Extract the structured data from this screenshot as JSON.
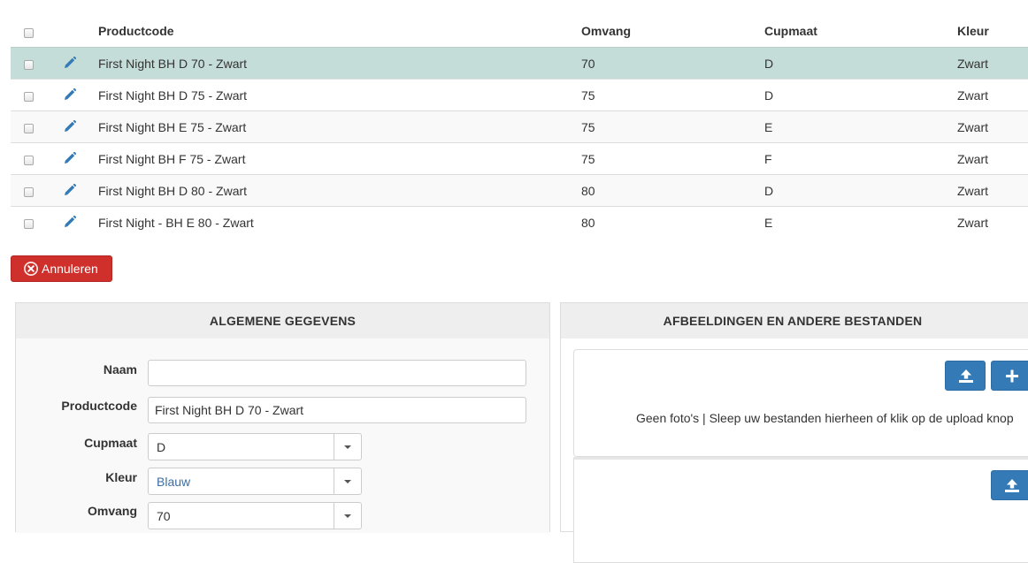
{
  "table": {
    "headers": {
      "productcode": "Productcode",
      "omvang": "Omvang",
      "cupmaat": "Cupmaat",
      "kleur": "Kleur"
    },
    "rows": [
      {
        "productcode": "First Night BH D 70 - Zwart",
        "omvang": "70",
        "cupmaat": "D",
        "kleur": "Zwart",
        "selected": true
      },
      {
        "productcode": "First Night BH D 75 - Zwart",
        "omvang": "75",
        "cupmaat": "D",
        "kleur": "Zwart"
      },
      {
        "productcode": "First Night BH E 75 - Zwart",
        "omvang": "75",
        "cupmaat": "E",
        "kleur": "Zwart"
      },
      {
        "productcode": "First Night BH F 75 - Zwart",
        "omvang": "75",
        "cupmaat": "F",
        "kleur": "Zwart"
      },
      {
        "productcode": "First Night BH D 80 - Zwart",
        "omvang": "80",
        "cupmaat": "D",
        "kleur": "Zwart"
      },
      {
        "productcode": "First Night - BH E 80 - Zwart",
        "omvang": "80",
        "cupmaat": "E",
        "kleur": "Zwart"
      }
    ]
  },
  "actions": {
    "cancel_label": "Annuleren",
    "cancel_icon": "times-circle-icon"
  },
  "general": {
    "title": "ALGEMENE GEGEVENS",
    "naam": {
      "label": "Naam",
      "value": ""
    },
    "productcode": {
      "label": "Productcode",
      "value": "First Night BH D 70 - Zwart"
    },
    "cupmaat": {
      "label": "Cupmaat",
      "value": "D"
    },
    "kleur": {
      "label": "Kleur",
      "value": "Blauw"
    },
    "omvang": {
      "label": "Omvang",
      "value": "70"
    }
  },
  "files": {
    "title": "AFBEELDINGEN EN ANDERE BESTANDEN",
    "empty_text": "Geen foto's | Sleep uw bestanden hierheen of klik op de upload knop",
    "upload_icon": "upload-icon",
    "add_icon": "plus-icon"
  },
  "colors": {
    "selected_row": "#c5ddd8",
    "cancel": "#d0302b",
    "primary": "#337ab7",
    "link_icon": "#337ab7"
  }
}
